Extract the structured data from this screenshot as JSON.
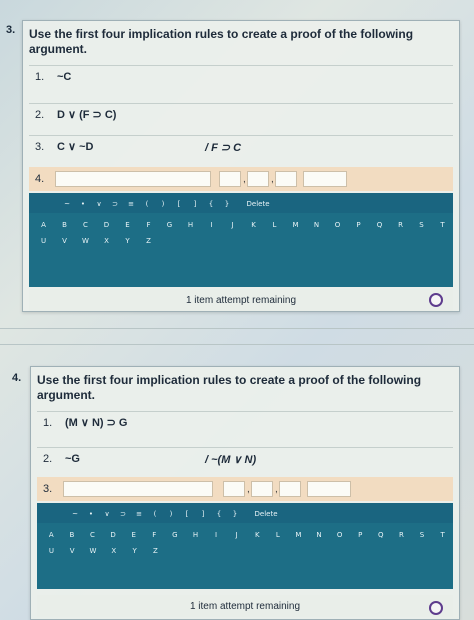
{
  "q3": {
    "number": "3.",
    "prompt_line1": "Use the first four implication rules to create a proof of the following",
    "prompt_line2": "argument.",
    "lines": [
      {
        "n": "1.",
        "formula": "~C"
      },
      {
        "n": "2.",
        "formula": "D ∨ (F ⊃ C)"
      },
      {
        "n": "3.",
        "formula": "C ∨ ~D"
      }
    ],
    "conclusion": "/ F ⊃ C",
    "entry_number": "4.",
    "symbols": [
      "~",
      "•",
      "∨",
      "⊃",
      "≡",
      "(",
      ")",
      "[",
      "]",
      "{",
      "}"
    ],
    "delete_label": "Delete",
    "letters_row1": [
      "A",
      "B",
      "C",
      "D",
      "E",
      "F",
      "G",
      "H",
      "I",
      "J",
      "K",
      "L",
      "M",
      "N",
      "O",
      "P",
      "Q",
      "R",
      "S",
      "T"
    ],
    "letters_row2": [
      "U",
      "V",
      "W",
      "X",
      "Y",
      "Z"
    ],
    "attempts": "1 item attempt remaining"
  },
  "q4": {
    "number": "4.",
    "prompt_line1": "Use the first four implication rules to create a proof of the following",
    "prompt_line2": "argument.",
    "lines": [
      {
        "n": "1.",
        "formula": "(M ∨ N) ⊃ G"
      },
      {
        "n": "2.",
        "formula": "~G"
      }
    ],
    "conclusion": "/ ~(M ∨ N)",
    "entry_number": "3.",
    "symbols": [
      "~",
      "•",
      "∨",
      "⊃",
      "≡",
      "(",
      ")",
      "[",
      "]",
      "{",
      "}"
    ],
    "delete_label": "Delete",
    "letters_row1": [
      "A",
      "B",
      "C",
      "D",
      "E",
      "F",
      "G",
      "H",
      "I",
      "J",
      "K",
      "L",
      "M",
      "N",
      "O",
      "P",
      "Q",
      "R",
      "S",
      "T"
    ],
    "letters_row2": [
      "U",
      "V",
      "W",
      "X",
      "Y",
      "Z"
    ],
    "attempts": "1 item attempt remaining"
  },
  "colors": {
    "keyboard": "#1d6e86",
    "entry_row": "#f2dcc1",
    "radio": "#5e3c8d"
  }
}
